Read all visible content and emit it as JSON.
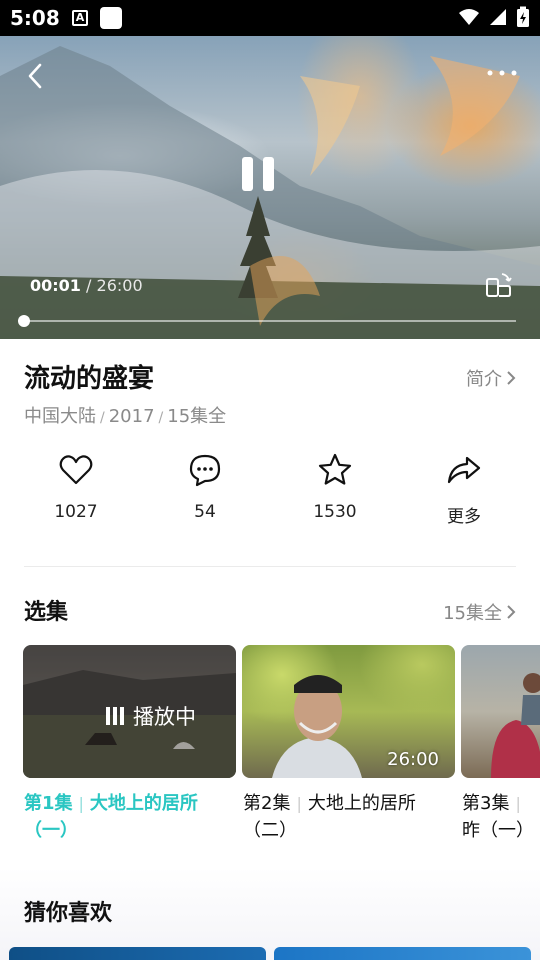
{
  "status_bar": {
    "time": "5:08",
    "icons": [
      "a-notification-icon",
      "square-notification-icon",
      "wifi-icon",
      "signal-icon",
      "battery-charging-icon"
    ]
  },
  "player": {
    "current_time": "00:01",
    "separator": "/",
    "total_time": "26:00",
    "progress_fraction": 0.0,
    "state": "playing",
    "icons": [
      "back-arrow-icon",
      "more-dots-icon",
      "pause-icon",
      "rotate-screen-icon"
    ]
  },
  "video_info": {
    "title": "流动的盛宴",
    "intro_label": "简介",
    "region": "中国大陆",
    "year": "2017",
    "episodes_total": "15集全",
    "meta_separator": "/"
  },
  "actions": [
    {
      "icon": "heart-icon",
      "label": "1027"
    },
    {
      "icon": "comment-icon",
      "label": "54"
    },
    {
      "icon": "star-icon",
      "label": "1530"
    },
    {
      "icon": "share-icon",
      "label": "更多"
    }
  ],
  "episodes_section": {
    "title": "选集",
    "count_label": "15集全",
    "playing_label": "播放中",
    "items": [
      {
        "ep": "第1集",
        "name": "大地上的居所（一）",
        "active": true
      },
      {
        "ep": "第2集",
        "name": "大地上的居所（二）",
        "duration": "26:00"
      },
      {
        "ep": "第3集",
        "name": "昨（一）"
      }
    ],
    "separator": "|"
  },
  "recommend_section": {
    "title": "猜你喜欢"
  },
  "colors": {
    "accent": "#2ac6c2",
    "muted_text": "#888888",
    "status_bar_bg": "#000000"
  }
}
